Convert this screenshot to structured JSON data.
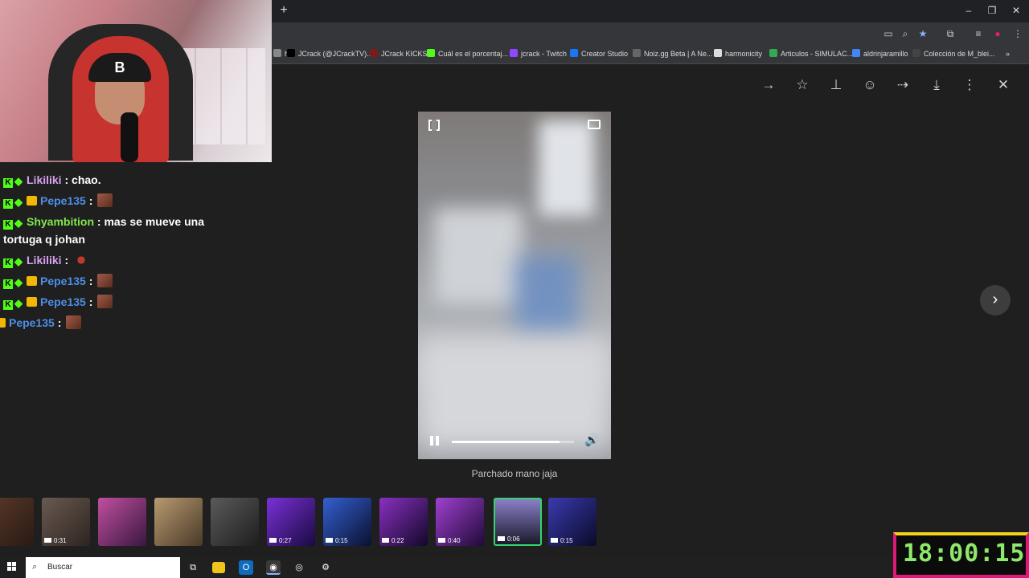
{
  "browser": {
    "new_tab_label": "+",
    "window_controls": {
      "minimize": "–",
      "restore": "❐",
      "close": "✕"
    },
    "bookmarks": [
      {
        "label": "h",
        "color": "#888888"
      },
      {
        "label": "JCrack (@JCrackTV)...",
        "color": "#000000"
      },
      {
        "label": "JCrack KICKS",
        "color": "#7a1c1c"
      },
      {
        "label": "Cuál es el porcentaj...",
        "color": "#53fc18"
      },
      {
        "label": "jcrack - Twitch",
        "color": "#9146ff"
      },
      {
        "label": "Creator Studio",
        "color": "#1877f2"
      },
      {
        "label": "Noiz.gg Beta | A Ne...",
        "color": "#666666"
      },
      {
        "label": "harmonicity",
        "color": "#dddddd"
      },
      {
        "label": "Articulos - SIMULAC...",
        "color": "#34a853"
      },
      {
        "label": "aldrinjaramillo",
        "color": "#4285f4"
      },
      {
        "label": "Colección de M_blei...",
        "color": "#444444"
      }
    ],
    "more_bookmarks": "»"
  },
  "chat": {
    "lines": [
      {
        "user": "Likiliki",
        "user_color": "purple",
        "sep": " : ",
        "text": "chao.",
        "crown": false,
        "emote": "none"
      },
      {
        "user": "Pepe135",
        "user_color": "blue",
        "sep": " : ",
        "text": "",
        "crown": true,
        "emote": "pepe"
      },
      {
        "user": "Shyambition",
        "user_color": "green",
        "sep": " : ",
        "text": "mas se mueve una",
        "crown": false,
        "emote": "none"
      },
      {
        "user": "",
        "user_color": "none",
        "sep": "",
        "text": "tortuga q johan",
        "crown": false,
        "emote": "none"
      },
      {
        "user": "Likiliki",
        "user_color": "purple",
        "sep": " : ",
        "text": "",
        "crown": false,
        "emote": "small"
      },
      {
        "user": "Pepe135",
        "user_color": "blue",
        "sep": " : ",
        "text": "",
        "crown": true,
        "emote": "pepe"
      },
      {
        "user": "Pepe135",
        "user_color": "blue",
        "sep": " : ",
        "text": "",
        "crown": true,
        "emote": "pepe"
      },
      {
        "user": "Pepe135",
        "user_color": "blue",
        "sep": " : ",
        "text": "",
        "crown": true,
        "emote": "pepe"
      }
    ]
  },
  "viewer": {
    "actions": [
      "arrow-right-icon",
      "star-icon",
      "pin-icon",
      "emoji-icon",
      "forward-icon",
      "download-icon",
      "more-vert-icon",
      "close-icon"
    ],
    "caption": "Parchado mano jaja",
    "progress_fraction": 0.88,
    "next_label": "›"
  },
  "thumbnails": [
    {
      "duration": "",
      "bg": "linear-gradient(135deg,#5a3a2a,#2a1a14)"
    },
    {
      "duration": "0:31",
      "bg": "linear-gradient(135deg,#6a5a50,#2d2420)"
    },
    {
      "duration": "",
      "bg": "linear-gradient(135deg,#c04fa0,#3a1740)"
    },
    {
      "duration": "",
      "bg": "linear-gradient(135deg,#b79a70,#4a3a28)"
    },
    {
      "duration": "",
      "bg": "linear-gradient(135deg,#5a5a5a,#1e1e1e)"
    },
    {
      "duration": "0:27",
      "bg": "linear-gradient(135deg,#7a30d8,#1a0a40)"
    },
    {
      "duration": "0:15",
      "bg": "linear-gradient(135deg,#3460d0,#0a1030)"
    },
    {
      "duration": "0:22",
      "bg": "linear-gradient(135deg,#8a30c0,#12082a)"
    },
    {
      "duration": "0:40",
      "bg": "linear-gradient(135deg,#a040d0,#200a38)"
    },
    {
      "duration": "0:06",
      "bg": "linear-gradient(180deg,#8a7fc8,#1a1a2a)",
      "selected": true
    },
    {
      "duration": "0:15",
      "bg": "linear-gradient(135deg,#3a3ab0,#0a0a28)"
    }
  ],
  "taskbar": {
    "search_placeholder": "Buscar"
  },
  "clock": {
    "time": "18:00:15"
  },
  "webcam": {
    "hat_letter": "B"
  }
}
